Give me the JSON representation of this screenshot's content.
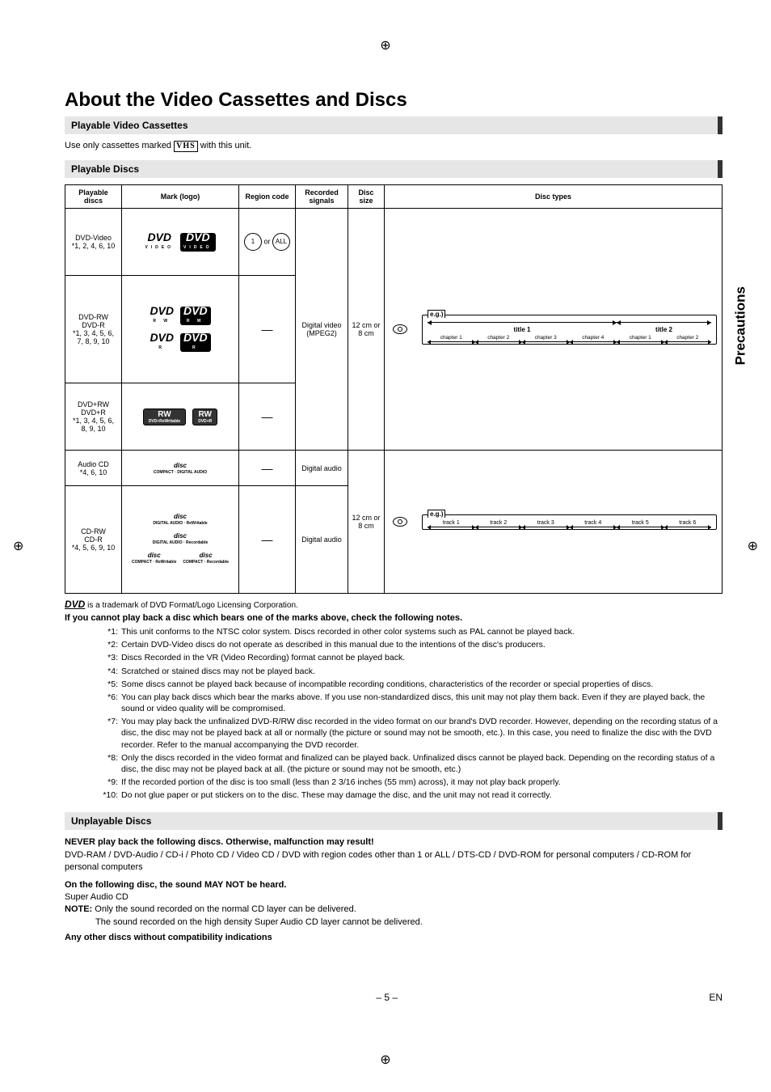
{
  "regmark_glyph": "⊕",
  "side_tab": "Precautions",
  "title": "About the Video Cassettes and Discs",
  "sections": {
    "cassettes_header": "Playable Video Cassettes",
    "cassettes_text_a": "Use only cassettes marked ",
    "cassettes_text_b": " with this unit.",
    "vhs_glyph": "VHS",
    "discs_header": "Playable Discs",
    "unplayable_header": "Unplayable Discs"
  },
  "table": {
    "headers": {
      "playable": "Playable discs",
      "logo": "Mark (logo)",
      "region": "Region code",
      "signals": "Recorded signals",
      "size": "Disc size",
      "types": "Disc types"
    },
    "rows": {
      "dvdvideo": {
        "name": "DVD-Video",
        "note": "*1, 2, 4, 6, 10",
        "region_or": "or"
      },
      "dvdrw": {
        "name_a": "DVD-RW",
        "name_b": "DVD-R",
        "note": "*1, 3, 4, 5, 6, 7, 8, 9, 10"
      },
      "dvdplus": {
        "name_a": "DVD+RW",
        "name_b": "DVD+R",
        "note": "*1, 3, 4, 5, 6, 8, 9, 10"
      },
      "audiocd": {
        "name": "Audio CD",
        "note": "*4, 6, 10"
      },
      "cdrw": {
        "name_a": "CD-RW",
        "name_b": "CD-R",
        "note": "*4, 5, 6, 9, 10"
      }
    },
    "signals": {
      "digital_video": "Digital video (MPEG2)",
      "digital_audio": "Digital audio"
    },
    "size": "12 cm or 8 cm",
    "dash": "—",
    "diagram1": {
      "eg": "e.g.)",
      "title1": "title 1",
      "title2": "title 2",
      "chapters_a": [
        "chapter 1",
        "chapter 2",
        "chapter 3",
        "chapter 4"
      ],
      "chapters_b": [
        "chapter 1",
        "chapter 2"
      ]
    },
    "diagram2": {
      "eg": "e.g.)",
      "tracks": [
        "track 1",
        "track 2",
        "track 3",
        "track 4",
        "track 5",
        "track 6"
      ]
    }
  },
  "trademark": " is a trademark of DVD Format/Logo Licensing Corporation.",
  "trademark_logo": "DVD",
  "notes_heading": "If you cannot play back a disc which bears one of the marks above, check the following notes.",
  "notes": [
    {
      "m": "*1:",
      "t": "This unit conforms to the NTSC color system. Discs recorded in other color systems such as PAL cannot be played back."
    },
    {
      "m": "*2:",
      "t": "Certain DVD-Video discs do not operate as described in this manual due to the intentions of the disc's producers."
    },
    {
      "m": "*3:",
      "t": "Discs Recorded in the VR (Video Recording) format cannot be played back."
    },
    {
      "m": "*4:",
      "t": "Scratched or stained discs may not be played back."
    },
    {
      "m": "*5:",
      "t": "Some discs cannot be played back because of incompatible recording conditions, characteristics of the recorder or special properties of discs."
    },
    {
      "m": "*6:",
      "t": "You can play back discs which bear the marks above. If you use non-standardized discs, this unit may not play them back. Even if they are played back, the sound or video quality will be compromised."
    },
    {
      "m": "*7:",
      "t": "You may play back the unfinalized DVD-R/RW disc recorded in the video format on our brand's DVD recorder. However, depending on the recording status of a disc, the disc may not be played back at all or normally (the picture or sound may not be smooth, etc.). In this case, you need to finalize the disc with the DVD recorder. Refer to the manual accompanying the DVD recorder."
    },
    {
      "m": "*8:",
      "t": "Only the discs recorded in the video format and finalized can be played back.\nUnfinalized discs cannot be played back. Depending on the recording status of a disc, the disc may not be played back at all. (the picture or sound may not be smooth, etc.)"
    },
    {
      "m": "*9:",
      "t": "If the recorded portion of the disc is too small (less than 2 3/16 inches (55 mm) across), it may not play back properly."
    },
    {
      "m": "*10:",
      "t": "Do not glue paper or put stickers on to the disc. These may damage the disc, and the unit may not read it correctly."
    }
  ],
  "unplayable": {
    "never": "NEVER play back the following discs. Otherwise, malfunction may result!",
    "list": "DVD-RAM / DVD-Audio / CD-i / Photo CD / Video CD / DVD with region codes other than 1 or ALL / DTS-CD / DVD-ROM for personal computers / CD-ROM for personal computers",
    "sound_heading": "On the following disc, the sound MAY NOT be heard.",
    "sacd": "Super Audio CD",
    "note_label": "NOTE:",
    "note_line1": " Only the sound recorded on the normal CD layer can be delivered.",
    "note_line2": "The sound recorded on the high density Super Audio CD layer cannot be delivered.",
    "other": "Any other discs without compatibility indications"
  },
  "footer": {
    "page": "– 5 –",
    "lang": "EN"
  }
}
